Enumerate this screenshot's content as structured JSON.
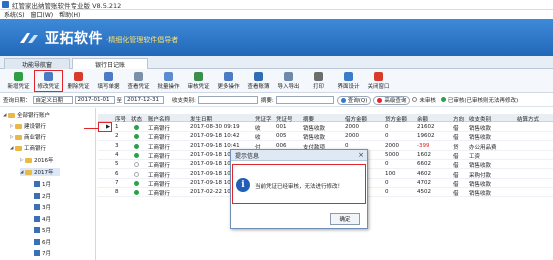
{
  "window": {
    "title": "红管家出纳管账软件专业版 V8.5.212"
  },
  "menu": [
    "系统(S)",
    "窗口(W)",
    "帮助(H)"
  ],
  "banner": {
    "brand": "亚拓软件",
    "slogan": "·精细化管理软件倡导者"
  },
  "tabs": [
    {
      "label": "功能导航窗"
    },
    {
      "label": "银行日记账"
    }
  ],
  "toolbar": [
    {
      "label": "新增凭证",
      "color": "#2f9e44"
    },
    {
      "label": "修改凭证",
      "color": "#4a7bc4"
    },
    {
      "label": "删除凭证",
      "color": "#d93a2b"
    },
    {
      "label": "填写单据",
      "color": "#4a7bc4"
    },
    {
      "label": "查看凭证",
      "color": "#7a8fa8"
    },
    {
      "label": "批量操作",
      "color": "#5b8bd0"
    },
    {
      "label": "审核凭证",
      "color": "#3a8f4c"
    },
    {
      "label": "更多操作",
      "color": "#4a7bc4"
    },
    {
      "label": "查看账簿",
      "color": "#2f6db5"
    },
    {
      "label": "导入导出",
      "color": "#6d8aaa"
    },
    {
      "label": "打印",
      "color": "#6d6d6d"
    },
    {
      "label": "界面设计",
      "color": "#3a7ccc"
    },
    {
      "label": "关闭窗口",
      "color": "#d93a2b"
    }
  ],
  "filter": {
    "date_label": "查询日期：",
    "date_mode": "自定义日期",
    "date_from": "2017-01-01",
    "to_label": "至",
    "date_to": "2017-12-31",
    "type_label": "收支类别:",
    "summary_label": "摘要:",
    "query_button": "查询(Q)",
    "advanced_button": "高级查询",
    "legend_unaudited": "未审核",
    "legend_audited": "已审核(已审核则无法再修改)",
    "legend_unaudited_color": "#ffffff",
    "legend_audited_color": "#2aa14a"
  },
  "tree": {
    "root": "全部银行账户",
    "banks": [
      "建设银行",
      "商业银行",
      "工商银行"
    ],
    "years": [
      "2016年",
      "2017年"
    ],
    "months": [
      "1月",
      "2月",
      "3月",
      "4月",
      "5月",
      "6月",
      "7月"
    ]
  },
  "grid": {
    "columns": [
      "序号",
      "状态",
      "账户名称",
      "发生日期",
      "凭证字",
      "凭证号",
      "摘要",
      "借方金额",
      "贷方金额",
      "余额",
      "方向",
      "收支类别",
      "结算方式"
    ],
    "rows": [
      {
        "no": "1",
        "status": "audited",
        "account": "工商银行",
        "date": "2017-08-30 09:19",
        "word": "收",
        "num": "001",
        "summary": "销售收款",
        "debit": "2000",
        "credit": "0",
        "balance": "21602",
        "dir": "借",
        "category": "销售收款"
      },
      {
        "no": "2",
        "status": "audited",
        "account": "工商银行",
        "date": "2017-09-18 10:42",
        "word": "收",
        "num": "005",
        "summary": "销售收款",
        "debit": "2000",
        "credit": "0",
        "balance": "19602",
        "dir": "借",
        "category": "销售收款"
      },
      {
        "no": "3",
        "status": "audited",
        "account": "工商银行",
        "date": "2017-09-18 10:41",
        "word": "付",
        "num": "006",
        "summary": "支付款项",
        "debit": "0",
        "credit": "2000",
        "balance": "-399",
        "dir": "贷",
        "category": "办公用品费"
      },
      {
        "no": "4",
        "status": "audited",
        "account": "工商银行",
        "date": "2017-09-18 10:40",
        "word": "",
        "num": "",
        "summary": "",
        "debit": "",
        "credit": "5000",
        "balance": "1602",
        "dir": "借",
        "category": "工资"
      },
      {
        "no": "5",
        "status": "unaudited",
        "account": "工商银行",
        "date": "2017-09-18 10:39",
        "word": "",
        "num": "",
        "summary": "",
        "debit": "",
        "credit": "0",
        "balance": "6602",
        "dir": "借",
        "category": "销售收款"
      },
      {
        "no": "6",
        "status": "unaudited",
        "account": "工商银行",
        "date": "2017-09-18 10:38",
        "word": "",
        "num": "",
        "summary": "",
        "debit": "",
        "credit": "100",
        "balance": "4602",
        "dir": "借",
        "category": "采购付款"
      },
      {
        "no": "7",
        "status": "audited",
        "account": "工商银行",
        "date": "2017-09-18 10:37",
        "word": "",
        "num": "",
        "summary": "",
        "debit": "",
        "credit": "0",
        "balance": "4702",
        "dir": "借",
        "category": "销售收款"
      },
      {
        "no": "8",
        "status": "audited",
        "account": "工商银行",
        "date": "2017-02-22 10:36",
        "word": "",
        "num": "",
        "summary": "",
        "debit": "",
        "credit": "0",
        "balance": "4502",
        "dir": "借",
        "category": "销售收款"
      }
    ]
  },
  "dialog": {
    "title": "提示信息",
    "close": "×",
    "message": "当前凭证已经审核，无法进行修改！",
    "ok": "确定"
  }
}
